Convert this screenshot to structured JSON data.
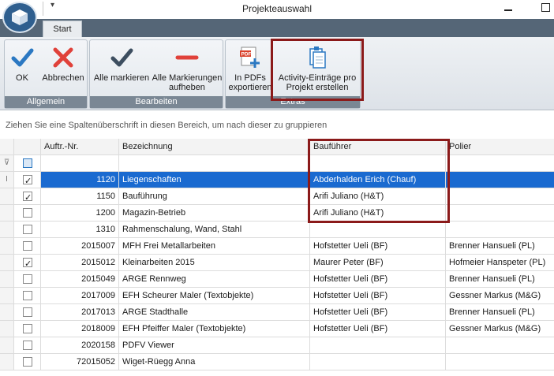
{
  "window": {
    "title": "Projekteauswahl"
  },
  "ribbon": {
    "tab": "Start",
    "groups": [
      {
        "label": "Allgemein",
        "buttons": [
          {
            "label": "OK"
          },
          {
            "label": "Abbrechen"
          }
        ]
      },
      {
        "label": "Bearbeiten",
        "buttons": [
          {
            "label": "Alle markieren"
          },
          {
            "label_line1": "Alle Markierungen",
            "label_line2": "aufheben"
          }
        ]
      },
      {
        "label": "Extras",
        "buttons": [
          {
            "label_line1": "In PDFs",
            "label_line2": "exportieren"
          },
          {
            "label_line1": "Activity-Einträge pro",
            "label_line2": "Projekt erstellen"
          }
        ]
      }
    ],
    "pdf_badge": "PDF"
  },
  "grid": {
    "group_hint": "Ziehen Sie eine Spaltenüberschrift in diesen Bereich, um nach dieser zu gruppieren",
    "columns": {
      "nr": "Auftr.-Nr.",
      "bezeichnung": "Bezeichnung",
      "baufuehrer": "Bauführer",
      "polier": "Polier"
    },
    "rows": [
      {
        "checked": true,
        "nr": "1120",
        "bezeichnung": "Liegenschaften",
        "baufuehrer": "Abderhalden Erich (Chauf)",
        "polier": ""
      },
      {
        "checked": true,
        "nr": "1150",
        "bezeichnung": "Bauführung",
        "baufuehrer": "Arifi Juliano (H&T)",
        "polier": ""
      },
      {
        "checked": false,
        "nr": "1200",
        "bezeichnung": "Magazin-Betrieb",
        "baufuehrer": "Arifi Juliano (H&T)",
        "polier": ""
      },
      {
        "checked": false,
        "nr": "1310",
        "bezeichnung": "Rahmenschalung, Wand, Stahl",
        "baufuehrer": "",
        "polier": ""
      },
      {
        "checked": false,
        "nr": "2015007",
        "bezeichnung": "MFH Frei Metallarbeiten",
        "baufuehrer": "Hofstetter Ueli (BF)",
        "polier": "Brenner Hansueli (PL)"
      },
      {
        "checked": true,
        "nr": "2015012",
        "bezeichnung": "Kleinarbeiten 2015",
        "baufuehrer": "Maurer Peter (BF)",
        "polier": "Hofmeier Hanspeter (PL)"
      },
      {
        "checked": false,
        "nr": "2015049",
        "bezeichnung": "ARGE Rennweg",
        "baufuehrer": "Hofstetter Ueli (BF)",
        "polier": "Brenner Hansueli (PL)"
      },
      {
        "checked": false,
        "nr": "2017009",
        "bezeichnung": "EFH Scheurer Maler (Textobjekte)",
        "baufuehrer": "Hofstetter Ueli (BF)",
        "polier": "Gessner Markus (M&G)"
      },
      {
        "checked": false,
        "nr": "2017013",
        "bezeichnung": "ARGE Stadthalle",
        "baufuehrer": "Hofstetter Ueli (BF)",
        "polier": "Brenner Hansueli (PL)"
      },
      {
        "checked": false,
        "nr": "2018009",
        "bezeichnung": "EFH Pfeiffer Maler (Textobjekte)",
        "baufuehrer": "Hofstetter Ueli (BF)",
        "polier": "Gessner Markus (M&G)"
      },
      {
        "checked": false,
        "nr": "2020158",
        "bezeichnung": "PDFV Viewer",
        "baufuehrer": "",
        "polier": ""
      },
      {
        "checked": false,
        "nr": "72015052",
        "bezeichnung": "Wiget-Rüegg Anna",
        "baufuehrer": "",
        "polier": ""
      }
    ],
    "selected_row_index": 0
  },
  "colors": {
    "accent": "#1a6ad0",
    "highlight_border": "#8b1a1a",
    "title_bar_strip": "#556677"
  }
}
